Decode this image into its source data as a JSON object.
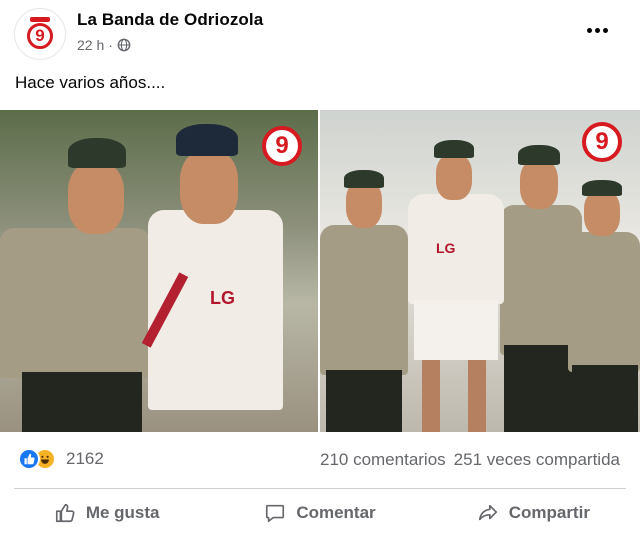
{
  "header": {
    "page_name": "La Banda de Odriozola",
    "time_ago": "22 h",
    "separator": "·",
    "avatar_logo_text": "9",
    "privacy_icon": "globe-icon",
    "more_icon": "more-options-icon"
  },
  "post": {
    "text": "Hace varios años...."
  },
  "photos": {
    "left": {
      "logo_text": "9"
    },
    "right": {
      "logo_text": "9"
    }
  },
  "stats": {
    "reaction_icons": [
      "like-reaction-icon",
      "haha-reaction-icon"
    ],
    "reaction_count": "2162",
    "comments": "210 comentarios",
    "shares": "251 veces compartida"
  },
  "actions": {
    "like_label": "Me gusta",
    "comment_label": "Comentar",
    "share_label": "Compartir"
  },
  "colors": {
    "brand_red": "#d71920",
    "facebook_blue": "#1877f2",
    "secondary_text": "#65676b"
  }
}
